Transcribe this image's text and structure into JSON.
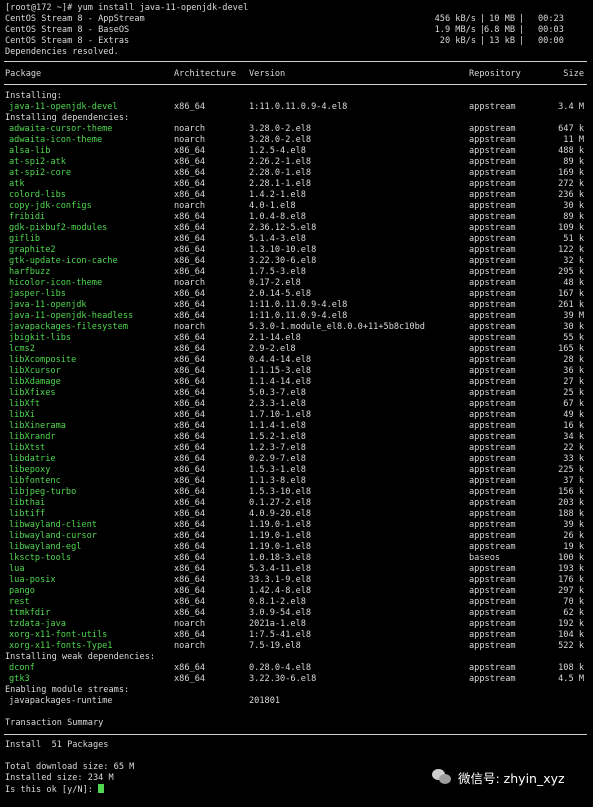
{
  "terminal": {
    "command_line": "[root@172 ~]# yum install java-11-openjdk-devel",
    "repo_status": [
      {
        "name": "CentOS Stream 8 - AppStream",
        "speed": "456 kB/s",
        "size": "10 MB",
        "time": "00:23"
      },
      {
        "name": "CentOS Stream 8 - BaseOS",
        "speed": "1.9 MB/s",
        "size": "6.8 MB",
        "time": "00:03"
      },
      {
        "name": "CentOS Stream 8 - Extras",
        "speed": "20 kB/s",
        "size": "13 kB",
        "time": "00:00"
      }
    ],
    "deps_resolved": "Dependencies resolved.",
    "table_headers": {
      "package": "Package",
      "arch": "Architecture",
      "version": "Version",
      "repo": "Repository",
      "size": "Size"
    },
    "section_installing": "Installing:",
    "installing": [
      {
        "name": "java-11-openjdk-devel",
        "arch": "x86_64",
        "version": "1:11.0.11.0.9-4.el8",
        "repo": "appstream",
        "size": "3.4 M"
      }
    ],
    "section_deps": "Installing dependencies:",
    "dependencies": [
      {
        "name": "adwaita-cursor-theme",
        "arch": "noarch",
        "version": "3.28.0-2.el8",
        "repo": "appstream",
        "size": "647 k"
      },
      {
        "name": "adwaita-icon-theme",
        "arch": "noarch",
        "version": "3.28.0-2.el8",
        "repo": "appstream",
        "size": "11 M"
      },
      {
        "name": "alsa-lib",
        "arch": "x86_64",
        "version": "1.2.5-4.el8",
        "repo": "appstream",
        "size": "488 k"
      },
      {
        "name": "at-spi2-atk",
        "arch": "x86_64",
        "version": "2.26.2-1.el8",
        "repo": "appstream",
        "size": "89 k"
      },
      {
        "name": "at-spi2-core",
        "arch": "x86_64",
        "version": "2.28.0-1.el8",
        "repo": "appstream",
        "size": "169 k"
      },
      {
        "name": "atk",
        "arch": "x86_64",
        "version": "2.28.1-1.el8",
        "repo": "appstream",
        "size": "272 k"
      },
      {
        "name": "colord-libs",
        "arch": "x86_64",
        "version": "1.4.2-1.el8",
        "repo": "appstream",
        "size": "236 k"
      },
      {
        "name": "copy-jdk-configs",
        "arch": "noarch",
        "version": "4.0-1.el8",
        "repo": "appstream",
        "size": "30 k"
      },
      {
        "name": "fribidi",
        "arch": "x86_64",
        "version": "1.0.4-8.el8",
        "repo": "appstream",
        "size": "89 k"
      },
      {
        "name": "gdk-pixbuf2-modules",
        "arch": "x86_64",
        "version": "2.36.12-5.el8",
        "repo": "appstream",
        "size": "109 k"
      },
      {
        "name": "giflib",
        "arch": "x86_64",
        "version": "5.1.4-3.el8",
        "repo": "appstream",
        "size": "51 k"
      },
      {
        "name": "graphite2",
        "arch": "x86_64",
        "version": "1.3.10-10.el8",
        "repo": "appstream",
        "size": "122 k"
      },
      {
        "name": "gtk-update-icon-cache",
        "arch": "x86_64",
        "version": "3.22.30-6.el8",
        "repo": "appstream",
        "size": "32 k"
      },
      {
        "name": "harfbuzz",
        "arch": "x86_64",
        "version": "1.7.5-3.el8",
        "repo": "appstream",
        "size": "295 k"
      },
      {
        "name": "hicolor-icon-theme",
        "arch": "noarch",
        "version": "0.17-2.el8",
        "repo": "appstream",
        "size": "48 k"
      },
      {
        "name": "jasper-libs",
        "arch": "x86_64",
        "version": "2.0.14-5.el8",
        "repo": "appstream",
        "size": "167 k"
      },
      {
        "name": "java-11-openjdk",
        "arch": "x86_64",
        "version": "1:11.0.11.0.9-4.el8",
        "repo": "appstream",
        "size": "261 k"
      },
      {
        "name": "java-11-openjdk-headless",
        "arch": "x86_64",
        "version": "1:11.0.11.0.9-4.el8",
        "repo": "appstream",
        "size": "39 M"
      },
      {
        "name": "javapackages-filesystem",
        "arch": "noarch",
        "version": "5.3.0-1.module_el8.0.0+11+5b8c10bd",
        "repo": "appstream",
        "size": "30 k"
      },
      {
        "name": "jbigkit-libs",
        "arch": "x86_64",
        "version": "2.1-14.el8",
        "repo": "appstream",
        "size": "55 k"
      },
      {
        "name": "lcms2",
        "arch": "x86_64",
        "version": "2.9-2.el8",
        "repo": "appstream",
        "size": "165 k"
      },
      {
        "name": "libXcomposite",
        "arch": "x86_64",
        "version": "0.4.4-14.el8",
        "repo": "appstream",
        "size": "28 k"
      },
      {
        "name": "libXcursor",
        "arch": "x86_64",
        "version": "1.1.15-3.el8",
        "repo": "appstream",
        "size": "36 k"
      },
      {
        "name": "libXdamage",
        "arch": "x86_64",
        "version": "1.1.4-14.el8",
        "repo": "appstream",
        "size": "27 k"
      },
      {
        "name": "libXfixes",
        "arch": "x86_64",
        "version": "5.0.3-7.el8",
        "repo": "appstream",
        "size": "25 k"
      },
      {
        "name": "libXft",
        "arch": "x86_64",
        "version": "2.3.3-1.el8",
        "repo": "appstream",
        "size": "67 k"
      },
      {
        "name": "libXi",
        "arch": "x86_64",
        "version": "1.7.10-1.el8",
        "repo": "appstream",
        "size": "49 k"
      },
      {
        "name": "libXinerama",
        "arch": "x86_64",
        "version": "1.1.4-1.el8",
        "repo": "appstream",
        "size": "16 k"
      },
      {
        "name": "libXrandr",
        "arch": "x86_64",
        "version": "1.5.2-1.el8",
        "repo": "appstream",
        "size": "34 k"
      },
      {
        "name": "libXtst",
        "arch": "x86_64",
        "version": "1.2.3-7.el8",
        "repo": "appstream",
        "size": "22 k"
      },
      {
        "name": "libdatrie",
        "arch": "x86_64",
        "version": "0.2.9-7.el8",
        "repo": "appstream",
        "size": "33 k"
      },
      {
        "name": "libepoxy",
        "arch": "x86_64",
        "version": "1.5.3-1.el8",
        "repo": "appstream",
        "size": "225 k"
      },
      {
        "name": "libfontenc",
        "arch": "x86_64",
        "version": "1.1.3-8.el8",
        "repo": "appstream",
        "size": "37 k"
      },
      {
        "name": "libjpeg-turbo",
        "arch": "x86_64",
        "version": "1.5.3-10.el8",
        "repo": "appstream",
        "size": "156 k"
      },
      {
        "name": "libthai",
        "arch": "x86_64",
        "version": "0.1.27-2.el8",
        "repo": "appstream",
        "size": "203 k"
      },
      {
        "name": "libtiff",
        "arch": "x86_64",
        "version": "4.0.9-20.el8",
        "repo": "appstream",
        "size": "188 k"
      },
      {
        "name": "libwayland-client",
        "arch": "x86_64",
        "version": "1.19.0-1.el8",
        "repo": "appstream",
        "size": "39 k"
      },
      {
        "name": "libwayland-cursor",
        "arch": "x86_64",
        "version": "1.19.0-1.el8",
        "repo": "appstream",
        "size": "26 k"
      },
      {
        "name": "libwayland-egl",
        "arch": "x86_64",
        "version": "1.19.0-1.el8",
        "repo": "appstream",
        "size": "19 k"
      },
      {
        "name": "lksctp-tools",
        "arch": "x86_64",
        "version": "1.0.18-3.el8",
        "repo": "baseos",
        "size": "100 k"
      },
      {
        "name": "lua",
        "arch": "x86_64",
        "version": "5.3.4-11.el8",
        "repo": "appstream",
        "size": "193 k"
      },
      {
        "name": "lua-posix",
        "arch": "x86_64",
        "version": "33.3.1-9.el8",
        "repo": "appstream",
        "size": "176 k"
      },
      {
        "name": "pango",
        "arch": "x86_64",
        "version": "1.42.4-8.el8",
        "repo": "appstream",
        "size": "297 k"
      },
      {
        "name": "rest",
        "arch": "x86_64",
        "version": "0.8.1-2.el8",
        "repo": "appstream",
        "size": "70 k"
      },
      {
        "name": "ttmkfdir",
        "arch": "x86_64",
        "version": "3.0.9-54.el8",
        "repo": "appstream",
        "size": "62 k"
      },
      {
        "name": "tzdata-java",
        "arch": "noarch",
        "version": "2021a-1.el8",
        "repo": "appstream",
        "size": "192 k"
      },
      {
        "name": "xorg-x11-font-utils",
        "arch": "x86_64",
        "version": "1:7.5-41.el8",
        "repo": "appstream",
        "size": "104 k"
      },
      {
        "name": "xorg-x11-fonts-Type1",
        "arch": "noarch",
        "version": "7.5-19.el8",
        "repo": "appstream",
        "size": "522 k"
      }
    ],
    "section_weak": "Installing weak dependencies:",
    "weak_dependencies": [
      {
        "name": "dconf",
        "arch": "x86_64",
        "version": "0.28.0-4.el8",
        "repo": "appstream",
        "size": "108 k"
      },
      {
        "name": "gtk3",
        "arch": "x86_64",
        "version": "3.22.30-6.el8",
        "repo": "appstream",
        "size": "4.5 M"
      }
    ],
    "section_modules": "Enabling module streams:",
    "module_streams": [
      {
        "name": "javapackages-runtime",
        "stream": "201801"
      }
    ],
    "transaction_summary": "Transaction Summary",
    "install_summary": "Install  51 Packages",
    "total_download": "Total download size: 65 M",
    "installed_size": "Installed size: 234 M",
    "prompt": "Is this ok [y/N]: "
  },
  "watermark": {
    "icon": "wechat-icon",
    "text": "微信号: zhyin_xyz"
  },
  "colors": {
    "background": "#000000",
    "text": "#d9d9d9",
    "package_name": "#4fd84f"
  }
}
